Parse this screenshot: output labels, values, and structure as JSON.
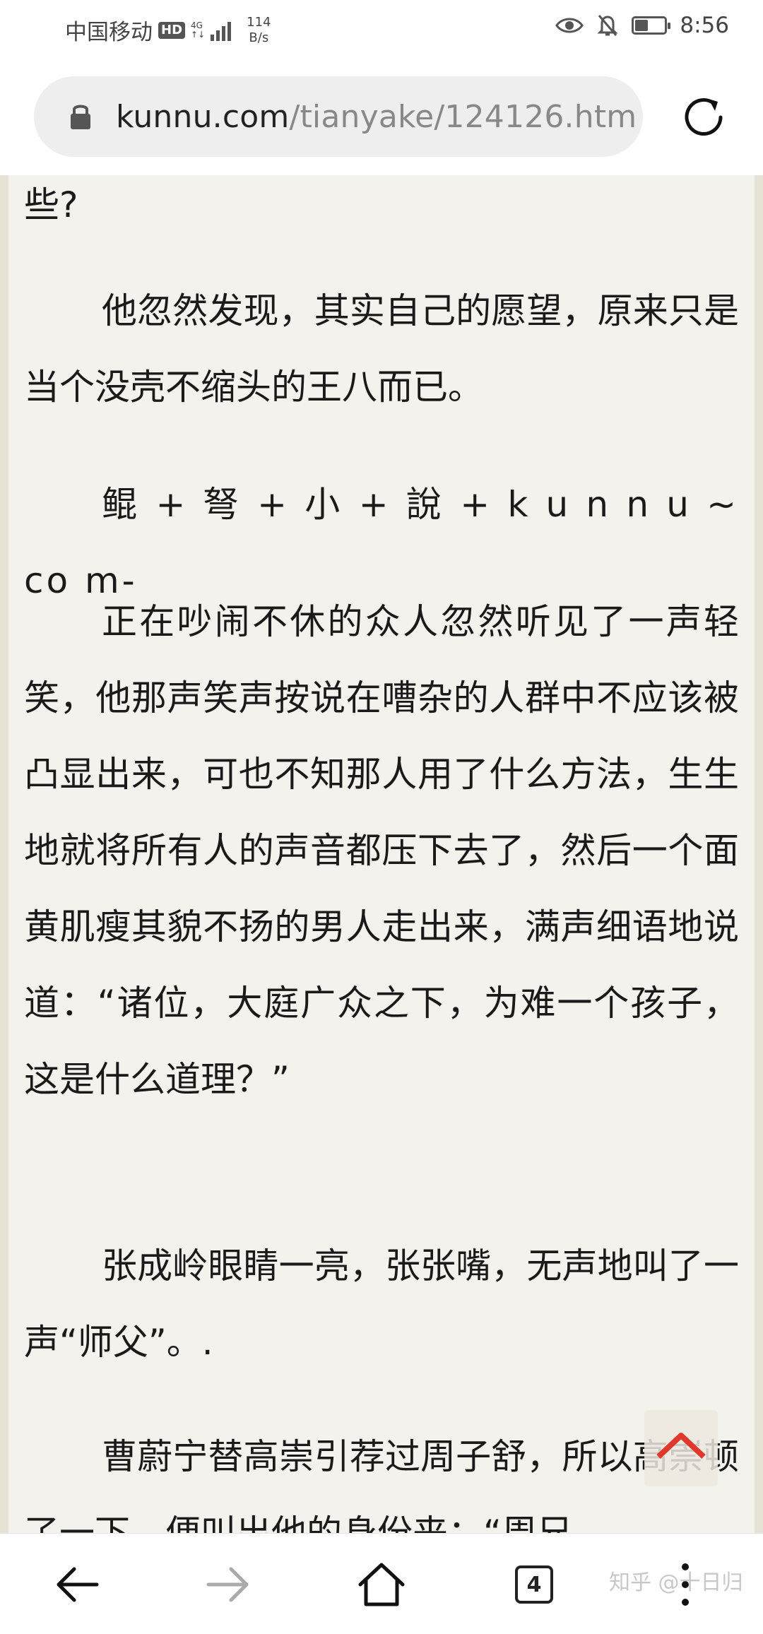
{
  "status_bar": {
    "carrier": "中国移动",
    "hd_badge": "HD",
    "network_type": "4G",
    "speed_value": "114",
    "speed_unit": "B/s",
    "time": "8:56",
    "battery_level": 0.45,
    "icons": [
      "eye-icon",
      "bell-off-icon",
      "battery-icon",
      "signal-icon"
    ]
  },
  "address_bar": {
    "url_domain": "kunnu.com",
    "url_path": "/tianyake/124126.htm",
    "icons": [
      "lock-icon",
      "reload-icon"
    ]
  },
  "article": {
    "paragraphs": [
      "些?",
      "他忽然发现，其实自己的愿望，原来只是当个没壳不缩头的王八而已。",
      "鲲 + 弩 + 小 + 說 + k u n n u ~ co m-",
      "正在吵闹不休的众人忽然听见了一声轻笑，他那声笑声按说在嘈杂的人群中不应该被凸显出来，可也不知那人用了什么方法，生生地就将所有人的声音都压下去了，然后一个面黄肌瘦其貌不扬的男人走出来，满声细语地说道：“诸位，大庭广众之下，为难一个孩子，这是什么道理？”",
      "张成岭眼睛一亮，张张嘴，无声地叫了一声“师父”。.",
      "曹蔚宁替高崇引荐过周子舒，所以高崇顿了一下，便叫出他的身份来：“周兄"
    ]
  },
  "bottom_nav": {
    "tab_count": "4",
    "icons": [
      "back-arrow-icon",
      "forward-arrow-icon",
      "home-icon",
      "tabs-icon",
      "more-icon"
    ]
  },
  "watermark": "知乎 @十日归",
  "colors": {
    "page_background": "#f4f2ec",
    "text": "#1a1a1a",
    "url_domain": "#222222",
    "url_path": "#888888",
    "back_to_top_accent": "#e0382c"
  }
}
